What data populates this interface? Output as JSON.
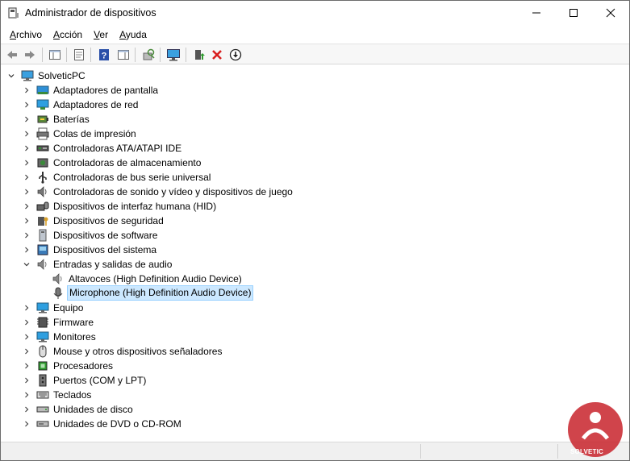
{
  "window": {
    "title": "Administrador de dispositivos"
  },
  "menu": {
    "items": [
      {
        "label": "Archivo",
        "accel": "A",
        "rest": "rchivo"
      },
      {
        "label": "Acción",
        "accel": "A",
        "rest": "cción"
      },
      {
        "label": "Ver",
        "accel": "V",
        "rest": "er"
      },
      {
        "label": "Ayuda",
        "accel": "A",
        "rest": "yuda"
      }
    ]
  },
  "toolbar": {
    "buttons": [
      "back-arrow-icon",
      "forward-arrow-icon",
      "show-hide-console-tree-icon",
      "properties-icon",
      "help-icon",
      "action-pane-icon",
      "scan-hardware-icon",
      "monitor-icon",
      "update-driver-icon",
      "uninstall-x-icon",
      "download-arrow-icon"
    ]
  },
  "tree": {
    "root": "SolveticPC",
    "items": [
      {
        "label": "Adaptadores de pantalla",
        "icon": "display-adapter-icon",
        "expanded": false
      },
      {
        "label": "Adaptadores de red",
        "icon": "network-adapter-icon",
        "expanded": false
      },
      {
        "label": "Baterías",
        "icon": "battery-icon",
        "expanded": false
      },
      {
        "label": "Colas de impresión",
        "icon": "printer-icon",
        "expanded": false
      },
      {
        "label": "Controladoras ATA/ATAPI IDE",
        "icon": "ide-controller-icon",
        "expanded": false
      },
      {
        "label": "Controladoras de almacenamiento",
        "icon": "storage-controller-icon",
        "expanded": false
      },
      {
        "label": "Controladoras de bus serie universal",
        "icon": "usb-icon",
        "expanded": false
      },
      {
        "label": "Controladoras de sonido y vídeo y dispositivos de juego",
        "icon": "speaker-icon",
        "expanded": false
      },
      {
        "label": "Dispositivos de interfaz humana (HID)",
        "icon": "hid-icon",
        "expanded": false
      },
      {
        "label": "Dispositivos de seguridad",
        "icon": "security-device-icon",
        "expanded": false
      },
      {
        "label": "Dispositivos de software",
        "icon": "software-device-icon",
        "expanded": false
      },
      {
        "label": "Dispositivos del sistema",
        "icon": "system-device-icon",
        "expanded": false
      },
      {
        "label": "Entradas y salidas de audio",
        "icon": "audio-io-icon",
        "expanded": true
      },
      {
        "label": "Altavoces (High Definition Audio Device)",
        "icon": "speaker-device-icon",
        "child": true
      },
      {
        "label": "Microphone (High Definition Audio Device)",
        "icon": "microphone-icon",
        "child": true,
        "selected": true
      },
      {
        "label": "Equipo",
        "icon": "computer-icon",
        "expanded": false
      },
      {
        "label": "Firmware",
        "icon": "firmware-icon",
        "expanded": false
      },
      {
        "label": "Monitores",
        "icon": "monitor-icon",
        "expanded": false
      },
      {
        "label": "Mouse y otros dispositivos señaladores",
        "icon": "mouse-icon",
        "expanded": false
      },
      {
        "label": "Procesadores",
        "icon": "processor-icon",
        "expanded": false
      },
      {
        "label": "Puertos (COM y LPT)",
        "icon": "port-icon",
        "expanded": false
      },
      {
        "label": "Teclados",
        "icon": "keyboard-icon",
        "expanded": false
      },
      {
        "label": "Unidades de disco",
        "icon": "disk-drive-icon",
        "expanded": false
      },
      {
        "label": "Unidades de DVD o CD-ROM",
        "icon": "dvd-drive-icon",
        "expanded": false
      }
    ]
  },
  "colors": {
    "selection_bg": "#cce8ff",
    "selection_border": "#99d1ff",
    "watermark": "#c8232c"
  },
  "watermark": {
    "text": "SOLVETIC"
  }
}
